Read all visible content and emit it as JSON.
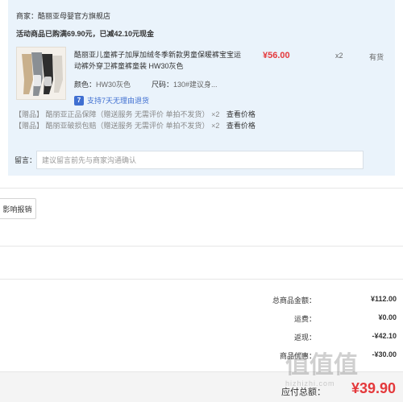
{
  "shop": {
    "label": "商家：",
    "name": "酷丽亚母婴官方旗舰店"
  },
  "promo": "活动商品已购满69.90元，已减42.10元现金",
  "product": {
    "title": "酷丽亚儿童裤子加厚加绒冬季新款男童保暖裤宝宝运动裤外穿卫裤童裤童装 HW30灰色",
    "price": "¥56.00",
    "quantity": "x2",
    "stock": "有货",
    "color_label": "颜色：",
    "color_value": "HW30灰色",
    "size_label": "尺码：",
    "size_value": "130#建议身...",
    "return_icon": "7",
    "return_text": "支持7天无理由退货"
  },
  "gifts": [
    {
      "tag": "【赠品】",
      "name": "酷丽亚正品保障（赠送服务 无需评价 单拍不发货）",
      "qty": "×2",
      "link": "查看价格"
    },
    {
      "tag": "【赠品】",
      "name": "酷丽亚破损包赔（赠送服务 无需评价 单拍不发货）",
      "qty": "×2",
      "link": "查看价格"
    }
  ],
  "message": {
    "label": "留言：",
    "placeholder": "建议留言前先与商家沟通确认"
  },
  "invoice_button": "影响报销",
  "summary": [
    {
      "label": "总商品金额：",
      "value": "¥112.00"
    },
    {
      "label": "运费：",
      "value": "¥0.00"
    },
    {
      "label": "返现：",
      "value": "-¥42.10"
    },
    {
      "label": "商品优惠：",
      "value": "-¥30.00"
    }
  ],
  "total": {
    "label": "应付总额：",
    "value": "¥39.90"
  },
  "watermark": {
    "logo": "值值值",
    "site": "hizhizhi.com"
  },
  "colors": {
    "accent_red": "#e4393c",
    "panel_bg": "#eaf3fb",
    "link_blue": "#3f6fd1"
  }
}
